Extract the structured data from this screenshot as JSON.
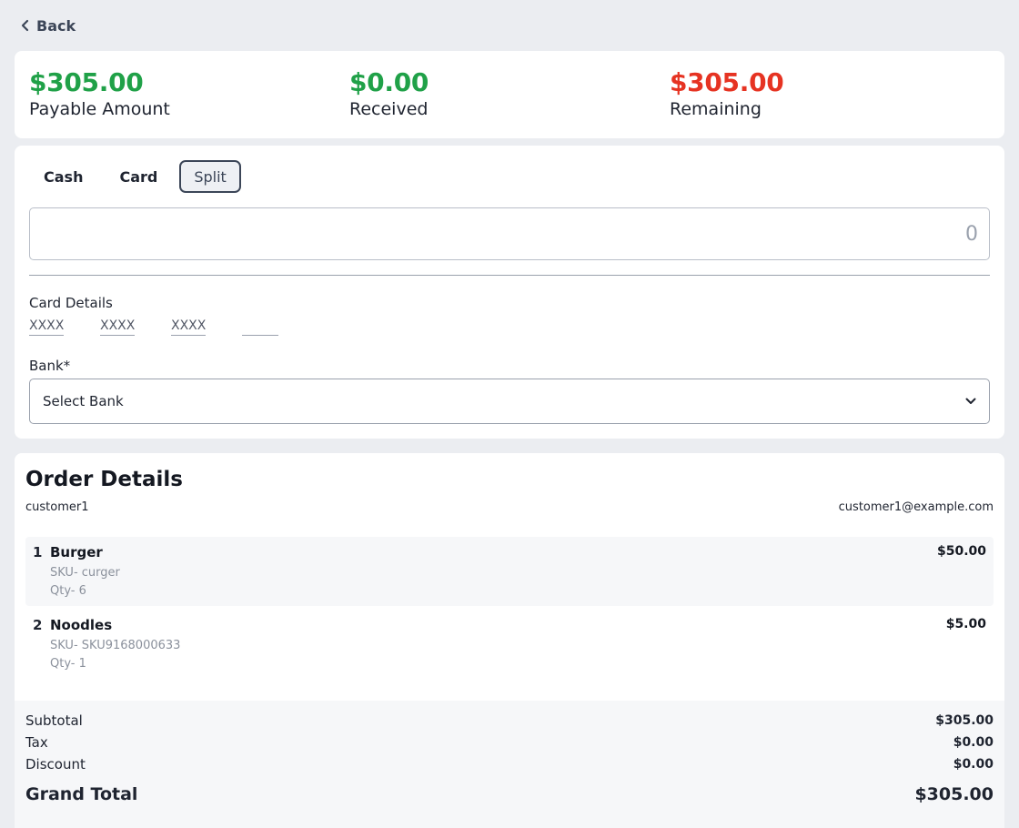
{
  "nav": {
    "back_label": "Back"
  },
  "summary": {
    "payable": {
      "amount": "$305.00",
      "label": "Payable Amount"
    },
    "received": {
      "amount": "$0.00",
      "label": "Received"
    },
    "remaining": {
      "amount": "$305.00",
      "label": "Remaining"
    }
  },
  "colors": {
    "positive": "#20a148",
    "negative": "#e63322",
    "accent": "#3c4658"
  },
  "payment": {
    "tabs": [
      {
        "label": "Cash",
        "active": false
      },
      {
        "label": "Card",
        "active": false
      },
      {
        "label": "Split",
        "active": true
      }
    ],
    "amount_placeholder": "0",
    "amount_value": "",
    "card_details_label": "Card Details",
    "card_placeholders": [
      "XXXX",
      "XXXX",
      "XXXX",
      ""
    ],
    "bank_label": "Bank*",
    "bank_selected": "Select Bank"
  },
  "order": {
    "title": "Order Details",
    "customer_name": "customer1",
    "customer_email": "customer1@example.com",
    "items": [
      {
        "index": "1",
        "name": "Burger",
        "sku": "SKU- curger",
        "qty": "Qty- 6",
        "price": "$50.00"
      },
      {
        "index": "2",
        "name": "Noodles",
        "sku": "SKU- SKU9168000633",
        "qty": "Qty- 1",
        "price": "$5.00"
      }
    ],
    "totals": {
      "subtotal_label": "Subtotal",
      "subtotal": "$305.00",
      "tax_label": "Tax",
      "tax": "$0.00",
      "discount_label": "Discount",
      "discount": "$0.00",
      "grand_label": "Grand Total",
      "grand": "$305.00"
    }
  }
}
